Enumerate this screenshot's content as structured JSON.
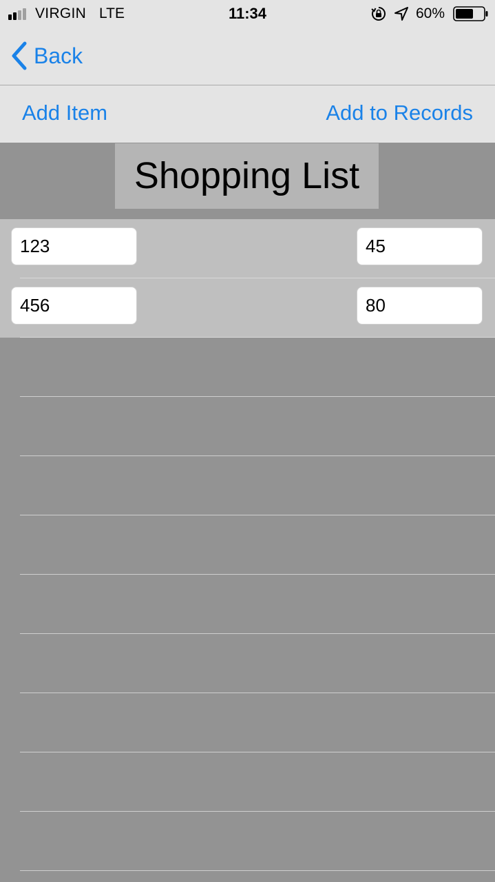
{
  "status_bar": {
    "carrier": "VIRGIN",
    "network": "LTE",
    "time": "11:34",
    "battery": "60%",
    "battery_level": 0.6,
    "signal_bars": 2,
    "icons": [
      "signal-icon",
      "orientation-lock-icon",
      "location-arrow-icon",
      "battery-icon"
    ]
  },
  "nav": {
    "back_label": "Back",
    "back_icon": "chevron-left-icon"
  },
  "toolbar": {
    "add_item_label": "Add Item",
    "add_records_label": "Add to Records"
  },
  "title": "Shopping List",
  "rows": [
    {
      "item": "123",
      "amount": "45"
    },
    {
      "item": "456",
      "amount": "80"
    }
  ],
  "colors": {
    "accent": "#1a82e8",
    "bar_background": "#e4e4e4",
    "page_background": "#939393",
    "filled_row": "#bfbfbf",
    "title_box": "#b5b5b5"
  }
}
